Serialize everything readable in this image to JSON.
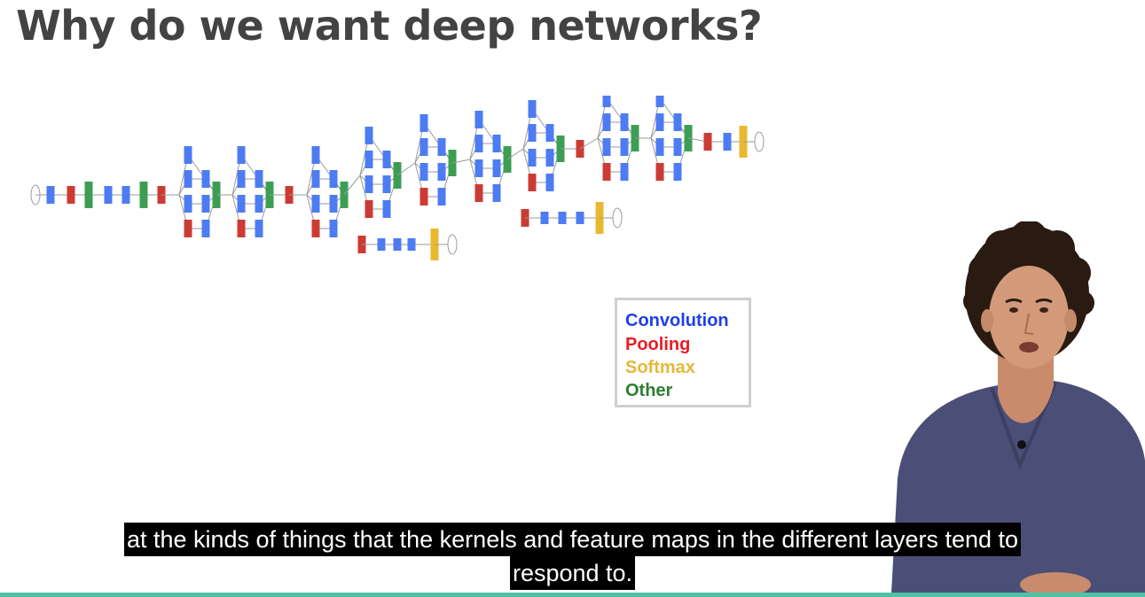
{
  "slide": {
    "title": "Why do we want deep networks?"
  },
  "legend": {
    "items": [
      {
        "label": "Convolution",
        "color": "#1f3fe6"
      },
      {
        "label": "Pooling",
        "color": "#e81d24"
      },
      {
        "label": "Softmax",
        "color": "#e5b83b"
      },
      {
        "label": "Other",
        "color": "#2e7d32"
      }
    ]
  },
  "diagram": {
    "colors": {
      "convolution": "#4d7cf2",
      "pooling": "#cc3b33",
      "softmax": "#e8b930",
      "other": "#3d9e53",
      "edge": "#9a9a9a",
      "io": "#ffffff"
    }
  },
  "caption": {
    "line1": "at the kinds of things that the kernels and feature maps in the different layers tend to",
    "line2": "respond to."
  },
  "presenter": {
    "icon": "presenter-video"
  },
  "theme": {
    "rule_color": "#4fc2a6",
    "title_color": "#434343",
    "caption_bg": "#000000",
    "caption_fg": "#ffffff"
  }
}
